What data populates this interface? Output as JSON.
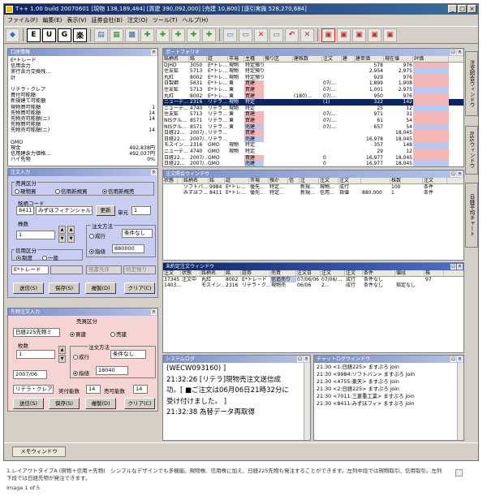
{
  "window": {
    "title": "T++ 1.00 build 20070601 [現物 138,189,484] [買建 390,092,000] [売建 10,800] [逐引実施 528,270,684]"
  },
  "menu": [
    "ファイル(F)",
    "編集(E)",
    "表示(V)",
    "証券会社(B)",
    "注文(O)",
    "ツール(T)",
    "ヘルプ(H)"
  ],
  "toolbar": {
    "letters": [
      "E",
      "U",
      "G",
      "楽"
    ]
  },
  "account": {
    "title": "口座情報",
    "lines": [
      [
        "E*トレード",
        ""
      ],
      [
        "信用余力",
        ""
      ],
      [
        "実行余力交換残…",
        ""
      ],
      [
        "計",
        ""
      ],
      [
        "",
        ""
      ],
      [
        "リテラ・クレア",
        ""
      ],
      [
        "買付可能額",
        ""
      ],
      [
        "新規建て可能額",
        ""
      ],
      [
        "現物買可能額",
        "1"
      ],
      [
        "先物買可能額",
        "14"
      ],
      [
        "先物売可能額(ニ)",
        "14"
      ],
      [
        "先物買可能額",
        ""
      ],
      [
        "先物売可能額(ニ)",
        "14"
      ],
      [
        "",
        ""
      ],
      [
        "GMO",
        ""
      ],
      [
        "現金",
        "492,838円"
      ],
      [
        "信用建余力価格…",
        "492,037円"
      ],
      [
        "ハイ先物",
        "0%"
      ]
    ]
  },
  "portfolio": {
    "title": "ポートフォリオ",
    "headers": [
      "銘柄名",
      "銘",
      "証",
      "市場",
      "主種",
      "預り区",
      "建株数",
      "注文",
      "建",
      "建単価",
      "現在値",
      "評価"
    ],
    "rows": [
      [
        "DJHD",
        "3050",
        "E*トレ…",
        "現物",
        "特定預り",
        "",
        "",
        "",
        "",
        "578",
        "976",
        ""
      ],
      [
        "住友鉱",
        "5713",
        "E*トレ…",
        "現物",
        "特定預り",
        "",
        "",
        "",
        "",
        "2,954",
        "2,975",
        ""
      ],
      [
        "丸紅",
        "8002",
        "E*トレ…",
        "現物",
        "特定預り",
        "",
        "",
        "",
        "",
        "929",
        "976",
        ""
      ],
      [
        "日製鋼",
        "5631",
        "E*トレ…",
        "東",
        "買建",
        "",
        "",
        "07/…",
        "",
        "1,899",
        "1,908",
        ""
      ],
      [
        "住友鉱",
        "5713",
        "E*トレ…",
        "東",
        "買建",
        "",
        "",
        "07/…",
        "",
        "1,001",
        "2,975",
        ""
      ],
      [
        "丸紅",
        "8002",
        "E*トレ…",
        "東",
        "買建",
        "",
        "(180)…",
        "07/…",
        "",
        "950",
        "976",
        ""
      ],
      [
        "ニューデ…",
        "2316",
        "リテラ…",
        "現物",
        "特定",
        "",
        "",
        "(1)",
        "",
        "322",
        "142",
        ""
      ],
      [
        "ニューデ…",
        "4740",
        "リテラ…",
        "現物",
        "特定",
        "",
        "",
        "",
        "",
        "25",
        "12",
        ""
      ],
      [
        "住友鉱",
        "5713",
        "リテラ…",
        "東",
        "買建",
        "",
        "",
        "07/…",
        "",
        "971",
        "31",
        ""
      ],
      [
        "NISグル…",
        "8571",
        "リテラ…",
        "東",
        "買建",
        "",
        "",
        "07/…",
        "",
        "61",
        "54",
        ""
      ],
      [
        "NISグル…",
        "8571",
        "リテラ…",
        "東",
        "売建",
        "",
        "",
        "07/…",
        "",
        "657",
        "54",
        ""
      ],
      [
        "日経22…",
        "2007/…",
        "リテラ…",
        "",
        "買建",
        "",
        "",
        "",
        "",
        "",
        "18,045",
        ""
      ],
      [
        "日経22…",
        "2007/…",
        "リテラ…",
        "",
        "売建",
        "",
        "",
        "",
        "",
        "16,978",
        "18,045",
        ""
      ],
      [
        "モスイン…",
        "2316",
        "GMO",
        "現物",
        "特定",
        "",
        "",
        "",
        "",
        "357",
        "148",
        ""
      ],
      [
        "ニューデ…",
        "4740",
        "GMO",
        "現物",
        "特定",
        "",
        "",
        "",
        "",
        "29",
        "12",
        ""
      ],
      [
        "日経22…",
        "2007/…",
        "GMO",
        "",
        "買建",
        "",
        "",
        "0",
        "",
        "16,977",
        "18,045",
        ""
      ],
      [
        "日経22…",
        "2007/…",
        "GMO",
        "",
        "売建",
        "",
        "",
        "0",
        "",
        "16,977",
        "18,045",
        ""
      ]
    ]
  },
  "order_list": {
    "title": "注文照会ウィンドウ",
    "headers": [
      "状態",
      "",
      "銘柄名",
      "銘",
      "証",
      "市場",
      "預か",
      "信",
      "注",
      "注文",
      "注文",
      "",
      "株数",
      "注文"
    ],
    "rows": [
      [
        "",
        "",
        "ソフトバ…",
        "9984",
        "E*トレ…",
        "優先…",
        "特定…",
        "",
        "新規…",
        "現物…",
        "成行",
        "",
        "100",
        "条件"
      ],
      [
        "",
        "",
        "みずほフ…",
        "8411",
        "E*トレ…",
        "優先…",
        "特定…",
        "",
        "新規…",
        "信用…",
        "指値",
        "880,000",
        "1",
        "条件"
      ]
    ]
  },
  "unexec": {
    "title": "未約定注文ウィンドウ",
    "headers": [
      "注文",
      "状態",
      "銘柄名",
      "銘",
      "証券",
      "売買",
      "注文日",
      "注文",
      "注文",
      "条件",
      "値段",
      "株"
    ],
    "rows": [
      [
        "37345",
        "注文中",
        "丸紅",
        "8002",
        "E*トレード",
        "信追売り",
        "07/06/06",
        "07/06/…",
        "成行",
        "条件なし",
        "",
        "97"
      ],
      [
        "1403…",
        "",
        "モスイン…",
        "2316",
        "リテラ・ク…",
        "現物売",
        "06/06",
        "2…",
        "成行",
        "条件なし",
        "指定なし",
        ""
      ]
    ]
  },
  "stock_order": {
    "title": "注文入力",
    "side_group": "売買区分",
    "side_options": [
      "現物買",
      "信用新規買",
      "信用新規売"
    ],
    "code_label": "銘柄コード",
    "code_value": "8411",
    "name_value": "みずほフィナンシャルグ",
    "update_btn": "更新",
    "unit_label": "単元",
    "unit_value": "1",
    "qty_label": "株数",
    "qty_value": "1",
    "method_label": "注文方法",
    "market_label": "成行",
    "cond_value": "条件なし",
    "limit_label": "指値",
    "price_value": "880000",
    "margin_label": "信用区分",
    "margin_options": [
      "制度",
      "一般"
    ],
    "broker_value": "E*トレード",
    "disabled1": "",
    "disabled2": "預書先序",
    "disabled3": "特定預り",
    "buttons": [
      "送信(S)",
      "保存(S)",
      "複製(D)",
      "クリア(C)"
    ]
  },
  "futures_order": {
    "title": "先物注文入力",
    "side_group": "売買区分",
    "contract_value": "日経225先物ミ",
    "side_options": [
      "買建",
      "売建"
    ],
    "qty_label": "枚数",
    "qty_value": "1",
    "method_label": "注文方法",
    "market_label": "成行",
    "cond_value": "条件なし",
    "month_value": "2007/06",
    "limit_label": "指値",
    "price_value": "18040",
    "broker_value": "リテラ・クレア",
    "buy_label": "実付能数",
    "buy_value": "14",
    "sell_label": "売可能数",
    "sell_value": "14",
    "buttons": [
      "送信(S)",
      "保存(S)",
      "複製(D)",
      "クリア(C)"
    ]
  },
  "syslog": {
    "title": "システムログ",
    "lines": [
      "(WECW093160) ]",
      "21:32:26 [リテラ]現物売注文送信成",
      "功。[ ■ご注文は06月06日21時32分に",
      "受け付けました。 ]",
      "21:32:38 為替データ再取得"
    ]
  },
  "chat": {
    "title": "チャットログウィンドウ",
    "lines": [
      "21:30 <1:日経225> ますぷろ join",
      "21:30 <9984:ソフトバン> ますぷろ join",
      "21:30 <4755:楽天> ますぷろ join",
      "21:30 <2:日経225> ますぷろ join",
      "21:30 <7011:三菱重工業> ますぷろ join",
      "21:30 <8411:みずほフィ> ますぷろ join"
    ]
  },
  "side_tabs": [
    "注文照会ウィンドウ",
    "RSSウィンドウ",
    "日経平均チャート"
  ],
  "memo_tab": "メモウィンドウ",
  "caption": "1.レイアウトタイプA (現物＋信用＋先物)　シンプルなデザインでも多機能。現物株、信用株に加え、日経225先物も発注することができます。左列中段では現物取引、信用取引。左列下段では日経先物が発注できます。",
  "pager": "Image 1 of 5"
}
